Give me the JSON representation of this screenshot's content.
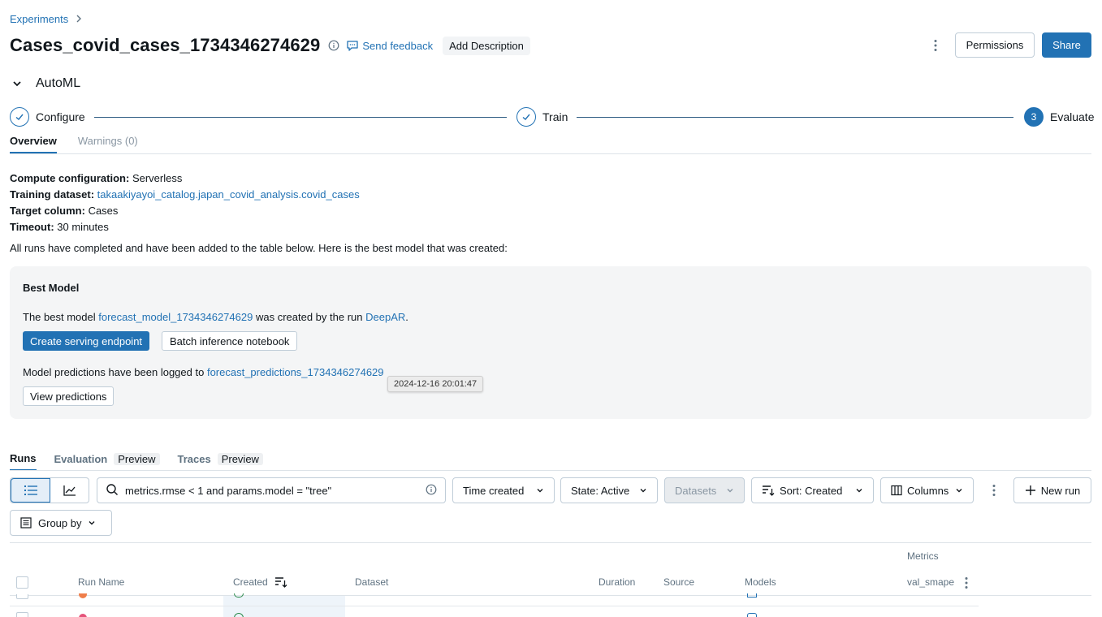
{
  "breadcrumb": {
    "experiments": "Experiments"
  },
  "header": {
    "title": "Cases_covid_cases_1734346274629",
    "send_feedback": "Send feedback",
    "add_description": "Add Description",
    "permissions": "Permissions",
    "share": "Share"
  },
  "automl": {
    "label": "AutoML",
    "steps": [
      {
        "label": "Configure",
        "state": "done"
      },
      {
        "label": "Train",
        "state": "done"
      },
      {
        "label": "Evaluate",
        "state": "current",
        "number": "3"
      }
    ]
  },
  "tabs": {
    "overview": "Overview",
    "warnings": "Warnings (0)"
  },
  "config": {
    "compute_label": "Compute configuration:",
    "compute_value": "Serverless",
    "dataset_label": "Training dataset:",
    "dataset_value": "takaakiyayoi_catalog.japan_covid_analysis.covid_cases",
    "target_label": "Target column:",
    "target_value": "Cases",
    "timeout_label": "Timeout:",
    "timeout_value": "30 minutes"
  },
  "summary": "All runs have completed and have been added to the table below. Here is the best model that was created:",
  "best_model": {
    "title": "Best Model",
    "prefix": "The best model",
    "model_link": "forecast_model_1734346274629",
    "middle": "was created by the run",
    "run_link": "DeepAR",
    "suffix": ".",
    "create_endpoint": "Create serving endpoint",
    "batch_notebook": "Batch inference notebook",
    "pred_prefix": "Model predictions have been logged to",
    "pred_link": "forecast_predictions_1734346274629",
    "view_predictions": "View predictions",
    "tooltip": "2024-12-16 20:01:47"
  },
  "runs_tabs": {
    "runs": "Runs",
    "evaluation": "Evaluation",
    "evaluation_badge": "Preview",
    "traces": "Traces",
    "traces_badge": "Preview"
  },
  "toolbar": {
    "search_value": "metrics.rmse < 1 and params.model = \"tree\"",
    "time_created": "Time created",
    "state": "State: Active",
    "datasets": "Datasets",
    "sort": "Sort: Created",
    "columns": "Columns",
    "new_run": "New run",
    "group_by": "Group by"
  },
  "table": {
    "metrics_group": "Metrics",
    "columns": {
      "run_name": "Run Name",
      "created": "Created",
      "dataset": "Dataset",
      "duration": "Duration",
      "source": "Source",
      "models": "Models",
      "val_smape": "val_smape"
    }
  },
  "colors": {
    "accent": "#2272b4",
    "text": "#11171c",
    "muted": "#5f7281"
  }
}
